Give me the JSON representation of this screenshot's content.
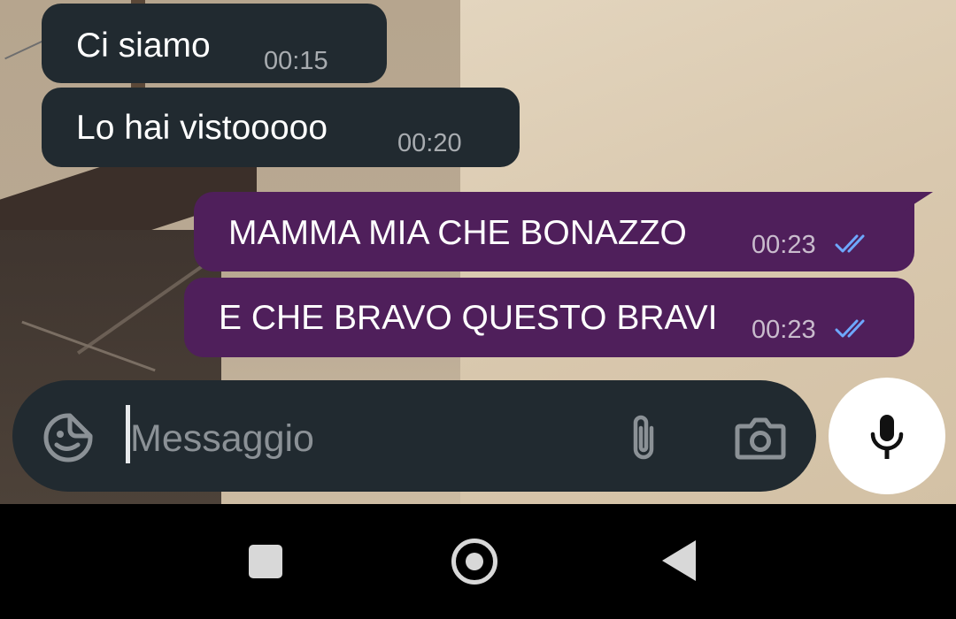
{
  "messages": [
    {
      "direction": "incoming",
      "text": "Ci siamo",
      "time": "00:15"
    },
    {
      "direction": "incoming",
      "text": "Lo hai vistooooo",
      "time": "00:20"
    },
    {
      "direction": "outgoing",
      "text": "MAMMA MIA CHE BONAZZO",
      "time": "00:23",
      "status_icon": "double-check-read-icon"
    },
    {
      "direction": "outgoing",
      "text": "E CHE BRAVO QUESTO BRAVI",
      "time": "00:23",
      "status_icon": "double-check-read-icon"
    }
  ],
  "composer": {
    "placeholder": "Messaggio",
    "sticker_icon": "sticker-icon",
    "attach_icon": "paperclip-icon",
    "camera_icon": "camera-icon",
    "mic_icon": "microphone-icon"
  },
  "navigation": {
    "recents_icon": "recents-square-icon",
    "home_icon": "home-circle-icon",
    "back_icon": "back-triangle-icon"
  },
  "colors": {
    "incoming_bubble": "#212a30",
    "outgoing_bubble": "#4f1f5b",
    "read_ticks": "#6ea8ff"
  }
}
